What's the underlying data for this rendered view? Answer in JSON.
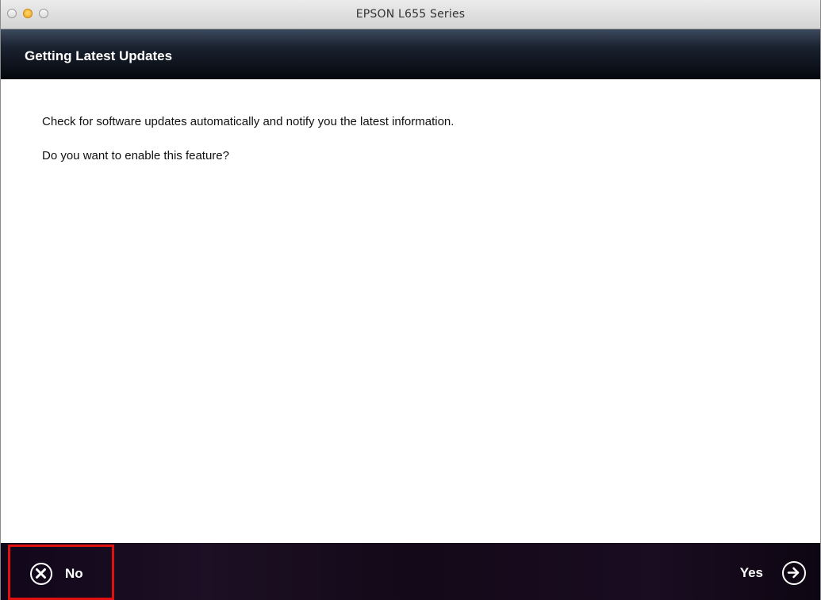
{
  "window": {
    "title": "EPSON L655 Series"
  },
  "header": {
    "title": "Getting Latest Updates"
  },
  "content": {
    "message": "Check for software updates automatically and notify you the latest information.",
    "question": "Do you want to enable this feature?"
  },
  "footer": {
    "no_label": "No",
    "no_icon": "close-circle-icon",
    "yes_label": "Yes",
    "yes_icon": "arrow-right-circle-icon",
    "highlight_color": "#e01010"
  }
}
